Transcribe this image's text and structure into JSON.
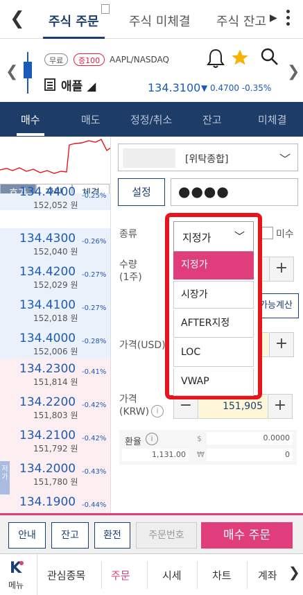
{
  "header": {
    "tabs": [
      "주식 주문",
      "주식 미체결",
      "주식 잔고"
    ],
    "active_tab": 0
  },
  "stock": {
    "badges": [
      "무료",
      "증100"
    ],
    "ticker": "AAPL/NASDAQ",
    "name": "애플",
    "price": "134.3100",
    "change": "▼ 0.4700 -0.35%"
  },
  "action_tabs": [
    "매수",
    "매도",
    "정정/취소",
    "잔고",
    "미체결"
  ],
  "sub_tabs": [
    "호가",
    "잔량",
    "체결"
  ],
  "quotes": [
    {
      "price": "134.4400",
      "krw": "152,052 원",
      "rate": "-0.25%",
      "side": "ask"
    },
    {
      "price": "134.4300",
      "krw": "152,040 원",
      "rate": "-0.26%",
      "side": "ask"
    },
    {
      "price": "134.4200",
      "krw": "152,029 원",
      "rate": "-0.27%",
      "side": "ask"
    },
    {
      "price": "134.4100",
      "krw": "152,018 원",
      "rate": "-0.27%",
      "side": "ask"
    },
    {
      "price": "134.4000",
      "krw": "152,006 원",
      "rate": "-0.28%",
      "side": "ask"
    },
    {
      "price": "134.2300",
      "krw": "151,814 원",
      "rate": "-0.41%",
      "side": "bid"
    },
    {
      "price": "134.2200",
      "krw": "151,803 원",
      "rate": "-0.42%",
      "side": "bid"
    },
    {
      "price": "134.2100",
      "krw": "151,792 원",
      "rate": "-0.42%",
      "side": "bid"
    },
    {
      "price": "134.2000",
      "krw": "151,780 원",
      "rate": "-0.43%",
      "side": "bid"
    },
    {
      "price": "134.1900",
      "krw": "",
      "rate": "-0.44%",
      "side": "bid"
    }
  ],
  "side_strip": "저가",
  "form": {
    "account": "[위탁종합]",
    "set_label": "설정",
    "password": "●●●●",
    "kind_label": "종류",
    "miss_label": "미수",
    "qty_label": "수량\n(1주)",
    "calc_label": "매수가능계산",
    "calc_visible": "가능계산",
    "usd_label": "가격(USD)",
    "usd_fragment": "0",
    "krw_label": "가격\n(KRW)",
    "krw_value": "151,905",
    "fx_label": "환율",
    "fx_rate": "1,131.00",
    "usd_amount": "0.0000",
    "krw_amount": "0",
    "usd_symbol": "$",
    "krw_symbol": "₩"
  },
  "dropdown": {
    "selected": "지정가",
    "options": [
      "지정가",
      "시장가",
      "AFTER지정",
      "LOC",
      "VWAP"
    ],
    "highlight_color": "#e8141c",
    "selected_color": "#e03d7c"
  },
  "bottom_actions": {
    "guide": "안내",
    "balance": "잔고",
    "exchange": "환전",
    "order_no": "주문번호",
    "buy": "매수 주문"
  },
  "nav": {
    "menu": "메뉴",
    "items": [
      "관심종목",
      "주문",
      "시세",
      "차트",
      "계좌"
    ],
    "active": 1
  }
}
